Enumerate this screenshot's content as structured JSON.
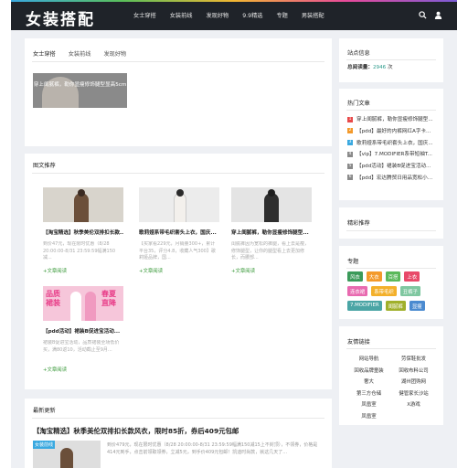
{
  "header": {
    "logo": "女装搭配",
    "nav": [
      "女士穿搭",
      "女装前线",
      "发现好物",
      "9.9精选",
      "专题",
      "男装搭配"
    ]
  },
  "tabs": {
    "items": [
      "女士穿搭",
      "女装前线",
      "发现好物"
    ],
    "active": 0,
    "slide_caption": "穿上闺腻裤，勒你显瘦修饰腿型显高5cm"
  },
  "picture_section": {
    "title": "图文推荐",
    "more": "+文章阅读",
    "posts": [
      {
        "title": "【淘宝精选】秋季美伦双排扣长款...",
        "desc": "到价47元，现在限时优惠（8/28 20:00:00-8/31 23:59:59幅满150减..."
      },
      {
        "title": "歌莉娅系带毛织套头上衣，国庆...",
        "desc": "【买家看229元，月销量300+，累计平台35，评分4.8，收藏人气300】歌莉娅品牌，国..."
      },
      {
        "title": "穿上闺腻裤，勒你显瘦修饰腿型...",
        "desc": "闺腻裤因为宽松的裤腿，看上去是瘦，修饰腿型，让你的腿型看上去更加修长，而腰部..."
      },
      {
        "title": "【pdd活动】裙装B促进宝活动...",
        "desc": "裙装B促进宝活动，品质裙装全场低价买，满80返10，活动截止至9月..."
      }
    ],
    "promo_banner": [
      "品质",
      "裙装",
      "春夏",
      "直降"
    ]
  },
  "latest": {
    "title": "最新更新",
    "headline": "【淘宝精选】秋季美伦双排扣长款风衣，限时85折，券后409元包邮",
    "badge": "女装前线",
    "desc": "到价479元，现在限时优惠（8/28 20:00:00-8/31 23:59:59幅满150减15上不封顶），不领券，价格是414元到手，点击前领取领券，立减5元，到手价409元包邮！凯迪时尚款，就这几天了..."
  },
  "sidebar": {
    "site_info": {
      "title": "站点信息",
      "label": "总阅读量：",
      "count": "2946",
      "unit": "次"
    },
    "hot_articles": {
      "title": "热门文章",
      "items": [
        {
          "n": "1",
          "text": "穿上闺腻裤，勒你显瘦修饰腿型..."
        },
        {
          "n": "2",
          "text": "【pdd】最好的内裤网红A字卡..."
        },
        {
          "n": "3",
          "text": "歌莉娅系带毛织套头上衣，国庆..."
        },
        {
          "n": "4",
          "text": "【vip】7.MODIFIER系带短袖T..."
        },
        {
          "n": "5",
          "text": "【pdd活动】裙装B促进宝活动..."
        },
        {
          "n": "6",
          "text": "【pdd】宏达腾贸日用品宽松小..."
        }
      ],
      "num_colors": [
        "#e84a4a",
        "#f39a2b",
        "#3aa9e0",
        "#8a8a8a",
        "#8a8a8a",
        "#8a8a8a"
      ]
    },
    "featured": {
      "title": "精彩推荐"
    },
    "topics": {
      "title": "专题",
      "tags": [
        {
          "text": "风衣",
          "color": "#3b9a5a"
        },
        {
          "text": "大衣",
          "color": "#f39a2b"
        },
        {
          "text": "百搭",
          "color": "#5ab85a"
        },
        {
          "text": "上衣",
          "color": "#e84a6a"
        },
        {
          "text": "连衣裙",
          "color": "#e86ab0"
        },
        {
          "text": "系带毛织",
          "color": "#f3b02b"
        },
        {
          "text": "丑裤子",
          "color": "#7fc7a0"
        },
        {
          "text": "7.MODIFIER",
          "color": "#4aa5a5"
        },
        {
          "text": "闺腻裤",
          "color": "#a0b02b"
        },
        {
          "text": "显瘦",
          "color": "#4a8ad0"
        }
      ]
    },
    "links": {
      "title": "友情链接",
      "items": [
        "网站导航",
        "劳保鞋批发",
        "回收品牌童装",
        "回收布料公司",
        "奢大",
        "湖州团购网",
        "第三方仓储",
        "健管家长沙站",
        "凤凰室",
        "X游戏",
        "凤凰室"
      ]
    }
  }
}
